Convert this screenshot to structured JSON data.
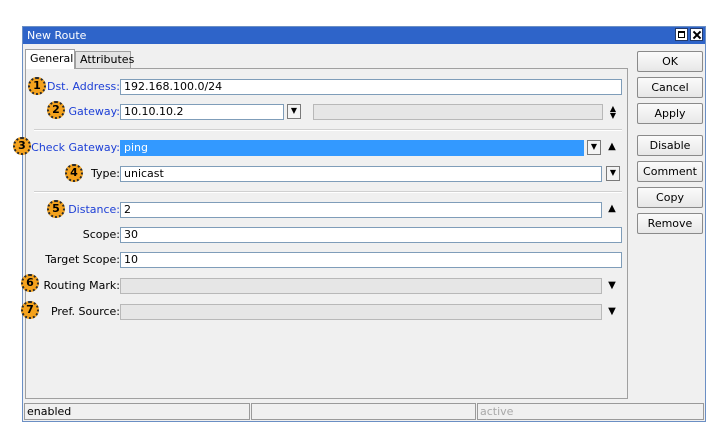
{
  "window": {
    "title": "New Route"
  },
  "tabs": [
    {
      "label": "General",
      "active": true
    },
    {
      "label": "Attributes",
      "active": false
    }
  ],
  "form": {
    "dst_address": {
      "label": "Dst. Address:",
      "value": "192.168.100.0/24"
    },
    "gateway": {
      "label": "Gateway:",
      "value": "10.10.10.2",
      "second_value": ""
    },
    "check_gateway": {
      "label": "Check Gateway:",
      "value": "ping"
    },
    "type": {
      "label": "Type:",
      "value": "unicast"
    },
    "distance": {
      "label": "Distance:",
      "value": "2"
    },
    "scope": {
      "label": "Scope:",
      "value": "30"
    },
    "target_scope": {
      "label": "Target Scope:",
      "value": "10"
    },
    "routing_mark": {
      "label": "Routing Mark:",
      "value": ""
    },
    "pref_source": {
      "label": "Pref. Source:",
      "value": ""
    }
  },
  "badges": [
    "1",
    "2",
    "3",
    "4",
    "5",
    "6",
    "7"
  ],
  "buttons": {
    "ok": "OK",
    "cancel": "Cancel",
    "apply": "Apply",
    "disable": "Disable",
    "comment": "Comment",
    "copy": "Copy",
    "remove": "Remove"
  },
  "status": {
    "left": "enabled",
    "middle": "",
    "right": "active"
  },
  "icons": {
    "dropdown": "dropdown-arrow-icon",
    "up": "triangle-up-icon",
    "down": "triangle-down-icon",
    "updown": "up-down-arrows-icon"
  },
  "colors": {
    "titlebar": "#2e64c9",
    "label_blue": "#1d3fd6",
    "selection": "#3399ff",
    "badge": "#f4a21d"
  }
}
